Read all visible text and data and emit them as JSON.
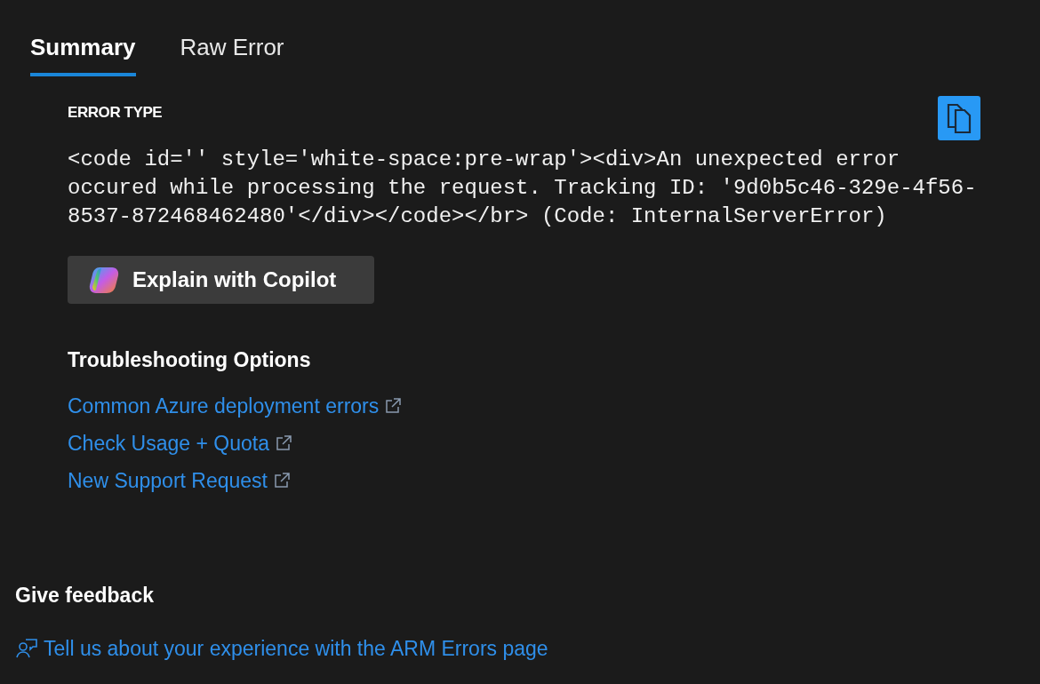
{
  "tabs": [
    {
      "label": "Summary",
      "selected": true
    },
    {
      "label": "Raw Error",
      "selected": false
    }
  ],
  "error": {
    "heading": "ERROR TYPE",
    "message": "<code id='' style='white-space:pre-wrap'><div>An unexpected error occured while processing the request. Tracking ID: '9d0b5c46-329e-4f56-8537-872468462480'</div></code></br> (Code: InternalServerError)"
  },
  "copilot_button": "Explain with Copilot",
  "troubleshooting": {
    "title": "Troubleshooting Options",
    "links": [
      "Common Azure deployment errors",
      "Check Usage + Quota",
      "New Support Request"
    ]
  },
  "feedback": {
    "title": "Give feedback",
    "link": "Tell us about your experience with the ARM Errors page"
  }
}
